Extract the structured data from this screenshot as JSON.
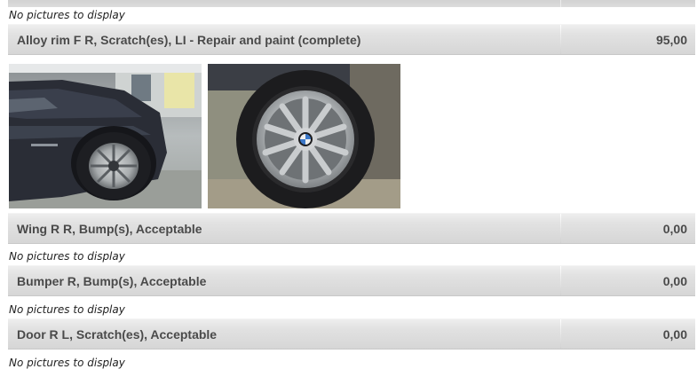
{
  "no_pictures_text": "No pictures to display",
  "items": [
    {
      "description": "Alloy rim F R, Scratch(es), LI - Repair and paint (complete)",
      "amount": "95,00"
    },
    {
      "description": "Wing R R, Bump(s), Acceptable",
      "amount": "0,00"
    },
    {
      "description": "Bumper R, Bump(s), Acceptable",
      "amount": "0,00"
    },
    {
      "description": "Door R L, Scratch(es), Acceptable",
      "amount": "0,00"
    }
  ],
  "photos": [
    {
      "name": "car-front-wheel-photo"
    },
    {
      "name": "wheel-closeup-photo"
    }
  ]
}
